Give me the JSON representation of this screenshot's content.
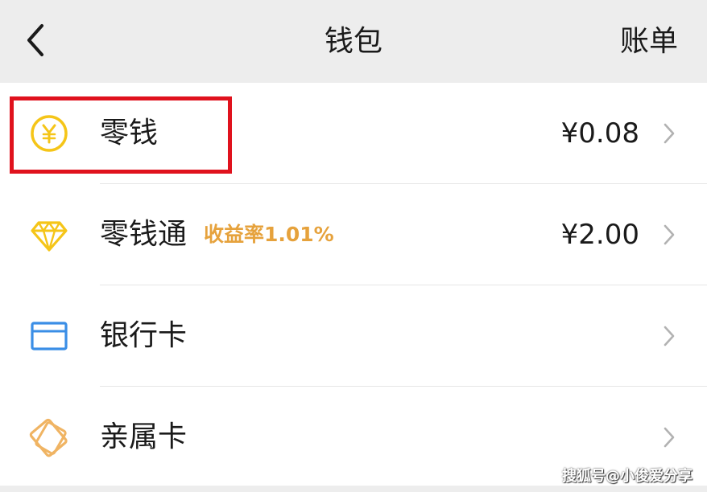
{
  "header": {
    "title": "钱包",
    "bills_label": "账单",
    "back_icon": "chevron-left-icon"
  },
  "wallet_items": [
    {
      "label": "零钱",
      "amount": "¥0.08",
      "icon": "yuan-coin-icon",
      "highlighted": true
    },
    {
      "label": "零钱通",
      "tag": "收益率1.01%",
      "amount": "¥2.00",
      "icon": "diamond-icon"
    },
    {
      "label": "银行卡",
      "icon": "bank-card-icon"
    },
    {
      "label": "亲属卡",
      "icon": "family-card-icon"
    }
  ],
  "watermark": "搜狐号@小俊爱分享",
  "colors": {
    "header_bg": "#ededed",
    "rate_orange": "#e6a23c",
    "coin_yellow": "#f5c518",
    "card_blue": "#3a8ee6",
    "family_orange": "#f0b463",
    "highlight_red": "#e0121d"
  }
}
